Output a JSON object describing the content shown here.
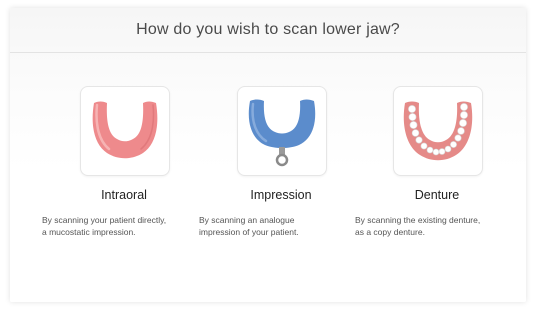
{
  "dialog": {
    "title": "How do you wish to scan lower jaw?"
  },
  "options": [
    {
      "label": "Intraoral",
      "description_line1": "By scanning your patient directly,",
      "description_line2": "a mucostatic impression.",
      "icon": "pink-gum-arch-icon",
      "color": "#ee8a8c"
    },
    {
      "label": "Impression",
      "description_line1": "By scanning an analogue",
      "description_line2": "impression of your patient.",
      "icon": "blue-impression-tray-icon",
      "color": "#5b8ccc"
    },
    {
      "label": "Denture",
      "description_line1": "By scanning the existing denture,",
      "description_line2": "as a copy denture.",
      "icon": "denture-arch-icon",
      "color": "#e58a88"
    }
  ]
}
